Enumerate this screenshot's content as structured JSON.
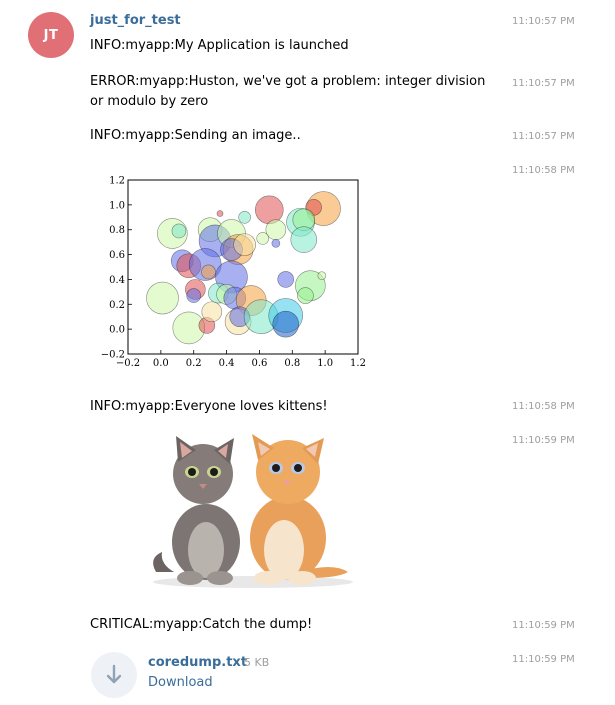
{
  "chat": {
    "avatar_initials": "JT",
    "sender": "just_for_test"
  },
  "messages": [
    {
      "text": "INFO:myapp:My Application is launched",
      "time": "11:10:57 PM"
    },
    {
      "text": "ERROR:myapp:Huston, we've got a problem: integer division or modulo by zero",
      "time": "11:10:57 PM"
    },
    {
      "text": "INFO:myapp:Sending an image..",
      "time": "11:10:57 PM"
    },
    {
      "text": "",
      "time": "11:10:58 PM",
      "attachment": "chart-image"
    },
    {
      "text": "INFO:myapp:Everyone loves kittens!",
      "time": "11:10:58 PM"
    },
    {
      "text": "",
      "time": "11:10:59 PM",
      "attachment": "kittens-photo"
    },
    {
      "text": "CRITICAL:myapp:Catch the dump!",
      "time": "11:10:59 PM"
    },
    {
      "text": "",
      "time": "11:10:59 PM",
      "attachment": "file"
    }
  ],
  "file": {
    "name": "coredump.txt",
    "size": "5 KB",
    "action": "Download",
    "icon": "download-arrow-icon"
  },
  "colors": {
    "avatar_bg": "#e17076",
    "link": "#3a6d99",
    "timestamp": "#9e9e9e"
  },
  "chart_data": {
    "type": "scatter",
    "title": "",
    "xlabel": "",
    "ylabel": "",
    "xlim": [
      -0.2,
      1.2
    ],
    "ylim": [
      -0.2,
      1.2
    ],
    "xticks": [
      "−0.2",
      "0.0",
      "0.2",
      "0.4",
      "0.6",
      "0.8",
      "1.0",
      "1.2"
    ],
    "yticks": [
      "−0.2",
      "0.0",
      "0.2",
      "0.4",
      "0.6",
      "0.8",
      "1.0",
      "1.2"
    ],
    "grid": false,
    "points": [
      {
        "x": 0.66,
        "y": 0.96,
        "s": 14,
        "c": "#e05050"
      },
      {
        "x": 0.99,
        "y": 0.97,
        "s": 17,
        "c": "#f7a040"
      },
      {
        "x": 0.93,
        "y": 0.98,
        "s": 8,
        "c": "#e05050"
      },
      {
        "x": 0.85,
        "y": 0.86,
        "s": 14,
        "c": "#7ee8c8"
      },
      {
        "x": 0.87,
        "y": 0.88,
        "s": 11,
        "c": "#98f090"
      },
      {
        "x": 0.87,
        "y": 0.72,
        "s": 13,
        "c": "#7ee8c8"
      },
      {
        "x": 0.7,
        "y": 0.8,
        "s": 10,
        "c": "#ccf8a8"
      },
      {
        "x": 0.51,
        "y": 0.9,
        "s": 6,
        "c": "#7ee8c8"
      },
      {
        "x": 0.36,
        "y": 0.93,
        "s": 3,
        "c": "#e05050"
      },
      {
        "x": 0.07,
        "y": 0.77,
        "s": 15,
        "c": "#ccf8a8"
      },
      {
        "x": 0.11,
        "y": 0.79,
        "s": 7,
        "c": "#7ee8c8"
      },
      {
        "x": 0.3,
        "y": 0.8,
        "s": 12,
        "c": "#ccf8a8"
      },
      {
        "x": 0.33,
        "y": 0.71,
        "s": 16,
        "c": "#6070e8"
      },
      {
        "x": 0.43,
        "y": 0.77,
        "s": 14,
        "c": "#ccf8a8"
      },
      {
        "x": 0.47,
        "y": 0.64,
        "s": 15,
        "c": "#f7a040"
      },
      {
        "x": 0.43,
        "y": 0.64,
        "s": 11,
        "c": "#6070e8"
      },
      {
        "x": 0.51,
        "y": 0.68,
        "s": 11,
        "c": "#f7e0a0"
      },
      {
        "x": 0.62,
        "y": 0.73,
        "s": 6,
        "c": "#ccf8a8"
      },
      {
        "x": 0.7,
        "y": 0.69,
        "s": 4,
        "c": "#6070e8"
      },
      {
        "x": 0.13,
        "y": 0.55,
        "s": 11,
        "c": "#6070e8"
      },
      {
        "x": 0.17,
        "y": 0.51,
        "s": 12,
        "c": "#e05050"
      },
      {
        "x": 0.27,
        "y": 0.52,
        "s": 16,
        "c": "#6070e8"
      },
      {
        "x": 0.29,
        "y": 0.46,
        "s": 7,
        "c": "#f7a040"
      },
      {
        "x": 0.43,
        "y": 0.42,
        "s": 16,
        "c": "#6070e8"
      },
      {
        "x": 0.21,
        "y": 0.32,
        "s": 10,
        "c": "#e05050"
      },
      {
        "x": 0.2,
        "y": 0.27,
        "s": 7,
        "c": "#6070e8"
      },
      {
        "x": 0.35,
        "y": 0.29,
        "s": 10,
        "c": "#7ee8c8"
      },
      {
        "x": 0.4,
        "y": 0.28,
        "s": 10,
        "c": "#ccf8a8"
      },
      {
        "x": 0.45,
        "y": 0.25,
        "s": 11,
        "c": "#6070e8"
      },
      {
        "x": 0.55,
        "y": 0.23,
        "s": 15,
        "c": "#f7a040"
      },
      {
        "x": 0.76,
        "y": 0.4,
        "s": 8,
        "c": "#6070e8"
      },
      {
        "x": 0.91,
        "y": 0.35,
        "s": 15,
        "c": "#98f090"
      },
      {
        "x": 0.88,
        "y": 0.27,
        "s": 8,
        "c": "#98f090"
      },
      {
        "x": 0.98,
        "y": 0.43,
        "s": 4,
        "c": "#ccf8a8"
      },
      {
        "x": 0.01,
        "y": 0.25,
        "s": 16,
        "c": "#ccf8a8"
      },
      {
        "x": 0.17,
        "y": 0.01,
        "s": 16,
        "c": "#ccf8a8"
      },
      {
        "x": 0.28,
        "y": 0.03,
        "s": 8,
        "c": "#e05050"
      },
      {
        "x": 0.31,
        "y": 0.14,
        "s": 10,
        "c": "#f7e0a0"
      },
      {
        "x": 0.47,
        "y": 0.06,
        "s": 13,
        "c": "#f7e0a0"
      },
      {
        "x": 0.48,
        "y": 0.1,
        "s": 10,
        "c": "#6070e8"
      },
      {
        "x": 0.61,
        "y": 0.1,
        "s": 17,
        "c": "#7ee8c8"
      },
      {
        "x": 0.76,
        "y": 0.11,
        "s": 17,
        "c": "#40c8e8"
      },
      {
        "x": 0.76,
        "y": 0.04,
        "s": 13,
        "c": "#2060c8"
      }
    ]
  }
}
